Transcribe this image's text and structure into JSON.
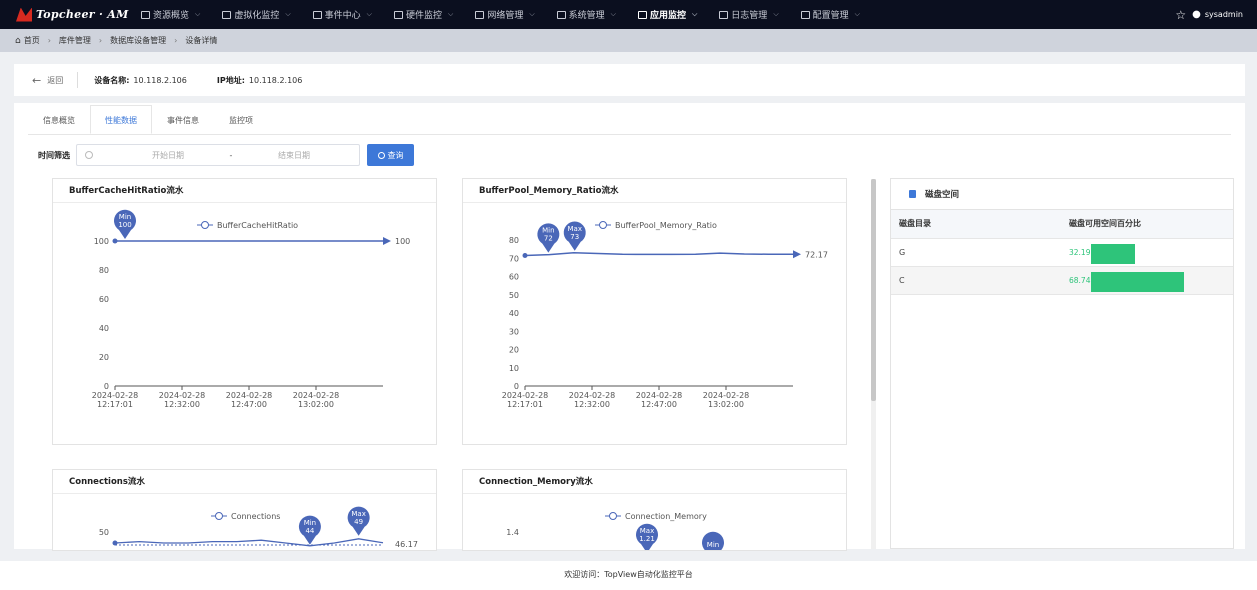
{
  "nav": {
    "logo": "Topcheer · AM",
    "items": [
      {
        "label": "资源概览",
        "active": false
      },
      {
        "label": "虚拟化监控",
        "active": false
      },
      {
        "label": "事件中心",
        "active": false
      },
      {
        "label": "硬件监控",
        "active": false
      },
      {
        "label": "网络管理",
        "active": false
      },
      {
        "label": "系统管理",
        "active": false
      },
      {
        "label": "应用监控",
        "active": true
      },
      {
        "label": "日志管理",
        "active": false
      },
      {
        "label": "配置管理",
        "active": false
      }
    ],
    "user": "sysadmin"
  },
  "breadcrumb": [
    "首页",
    "库件管理",
    "数据库设备管理",
    "设备详情"
  ],
  "info": {
    "back": "返回",
    "device_label": "设备名称:",
    "device_value": "10.118.2.106",
    "ip_label": "IP地址:",
    "ip_value": "10.118.2.106"
  },
  "tabs": [
    {
      "label": "信息概览",
      "active": false
    },
    {
      "label": "性能数据",
      "active": true
    },
    {
      "label": "事件信息",
      "active": false
    },
    {
      "label": "监控项",
      "active": false
    }
  ],
  "filter": {
    "label": "时间筛选",
    "start_placeholder": "开始日期",
    "separator": "-",
    "end_placeholder": "结束日期",
    "query": "查询"
  },
  "chart_data": [
    {
      "type": "line",
      "title": "BufferCacheHitRatio流水",
      "legend": "BufferCacheHitRatio",
      "x_ticks": [
        "2024-02-28 12:17:01",
        "2024-02-28 12:32:00",
        "2024-02-28 12:47:00",
        "2024-02-28 13:02:00"
      ],
      "y_ticks": [
        0,
        20,
        40,
        60,
        80,
        100
      ],
      "ylim": [
        0,
        100
      ],
      "values": [
        100,
        100,
        100,
        100,
        100,
        100,
        100,
        100,
        100,
        100,
        100,
        100
      ],
      "min_label": "Min",
      "min_value": 100,
      "last_value": "100"
    },
    {
      "type": "line",
      "title": "BufferPool_Memory_Ratio流水",
      "legend": "BufferPool_Memory_Ratio",
      "x_ticks": [
        "2024-02-28 12:17:01",
        "2024-02-28 12:32:00",
        "2024-02-28 12:47:00",
        "2024-02-28 13:02:00"
      ],
      "y_ticks": [
        0,
        10,
        20,
        30,
        40,
        50,
        60,
        70,
        80
      ],
      "ylim": [
        0,
        80
      ],
      "values": [
        71.5,
        72,
        73,
        72.6,
        72.2,
        72.1,
        72.1,
        72.2,
        72.8,
        72.3,
        72.2,
        72.17
      ],
      "min_label": "Min",
      "min_value": 72,
      "max_label": "Max",
      "max_value": 73,
      "last_value": "72.17"
    },
    {
      "type": "line",
      "title": "Connections流水",
      "legend": "Connections",
      "y_ticks": [
        50
      ],
      "values": [
        46,
        47,
        46,
        46,
        47,
        47,
        48,
        46,
        44,
        46,
        49,
        46.17
      ],
      "min_label": "Min",
      "min_value": 44,
      "max_label": "Max",
      "max_value": 49,
      "last_value": "46.17"
    },
    {
      "type": "line",
      "title": "Connection_Memory流水",
      "legend": "Connection_Memory",
      "y_ticks": [
        1.4
      ],
      "max_label": "Max",
      "max_value": 1.21,
      "min_label": "Min"
    }
  ],
  "disk": {
    "title": "磁盘空间",
    "col1": "磁盘目录",
    "col2": "磁盘可用空间百分比",
    "rows": [
      {
        "dir": "G",
        "pct": 32.19,
        "pct_text": "32.19"
      },
      {
        "dir": "C",
        "pct": 68.74,
        "pct_text": "68.74"
      }
    ]
  },
  "footer": "欢迎访问：TopView自动化监控平台"
}
